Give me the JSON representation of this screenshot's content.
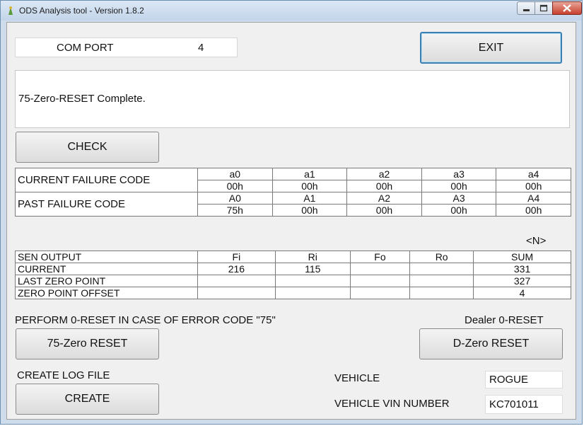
{
  "window": {
    "title": "ODS Analysis tool - Version 1.8.2"
  },
  "com_port": {
    "label": "COM PORT",
    "value": "4"
  },
  "exit_button": "EXIT",
  "status_message": "75-Zero-RESET Complete.",
  "check_button": "CHECK",
  "failure_table": {
    "current": {
      "label": "CURRENT FAILURE CODE",
      "codes": [
        "a0",
        "a1",
        "a2",
        "a3",
        "a4"
      ],
      "values": [
        "00h",
        "00h",
        "00h",
        "00h",
        "00h"
      ]
    },
    "past": {
      "label": "PAST FAILURE CODE",
      "codes": [
        "A0",
        "A1",
        "A2",
        "A3",
        "A4"
      ],
      "values": [
        "75h",
        "00h",
        "00h",
        "00h",
        "00h"
      ]
    }
  },
  "unit_label": "<N>",
  "sensor_table": {
    "header": [
      "SEN OUTPUT",
      "Fi",
      "Ri",
      "Fo",
      "Ro",
      "SUM"
    ],
    "rows": [
      [
        "CURRENT",
        "216",
        "115",
        "",
        "",
        "331"
      ],
      [
        "LAST ZERO POINT",
        "",
        "",
        "",
        "",
        "327"
      ],
      [
        "ZERO POINT OFFSET",
        "",
        "",
        "",
        "",
        "4"
      ]
    ]
  },
  "zero_reset_note": "PERFORM 0-RESET IN CASE OF ERROR CODE \"75\"",
  "zero_reset_button": "75-Zero RESET",
  "dealer_reset_label": "Dealer 0-RESET",
  "dealer_reset_button": "D-Zero RESET",
  "log_file_label": "CREATE LOG FILE",
  "create_button": "CREATE",
  "vehicle": {
    "label": "VEHICLE",
    "value": "ROGUE"
  },
  "vin": {
    "label": "VEHICLE VIN NUMBER",
    "value": "KC701011"
  }
}
